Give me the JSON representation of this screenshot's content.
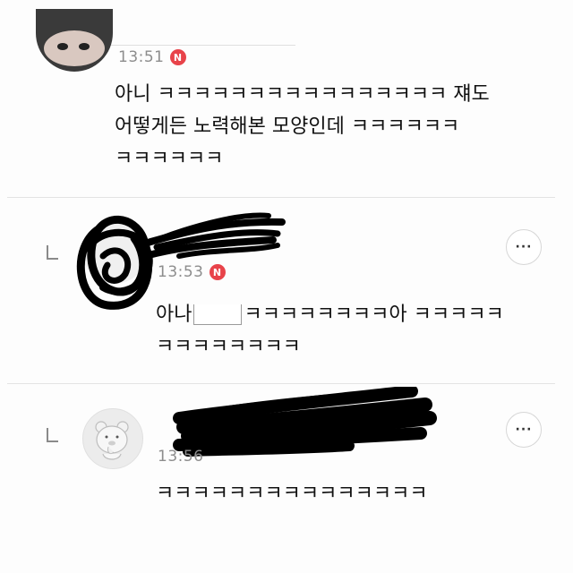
{
  "comments": [
    {
      "time": "13:51",
      "badge": "N",
      "text_line1": "아니 ㅋㅋㅋㅋㅋㅋㅋㅋㅋㅋㅋㅋㅋㅋㅋㅋ 쟤도",
      "text_line2": "어떻게든 노력해본 모양인데 ㅋㅋㅋㅋㅋㅋ",
      "text_line3": "ㅋㅋㅋㅋㅋㅋ"
    },
    {
      "time": "13:53",
      "badge": "N",
      "text_line1_prefix": "아나",
      "text_line1_suffix": "ㅋㅋㅋㅋㅋㅋㅋㅋ아 ㅋㅋㅋㅋㅋ",
      "text_line2": "ㅋㅋㅋㅋㅋㅋㅋㅋ",
      "more_label": "···"
    },
    {
      "time": "13:56",
      "text_line1": "ㅋㅋㅋㅋㅋㅋㅋㅋㅋㅋㅋㅋㅋㅋㅋ",
      "more_label": "···",
      "avatar_icon": "bear-character-icon"
    }
  ],
  "colors": {
    "badge": "#e8434a",
    "redaction": "#000000",
    "divider": "#e3e3e3",
    "time": "#8d8d8d"
  }
}
